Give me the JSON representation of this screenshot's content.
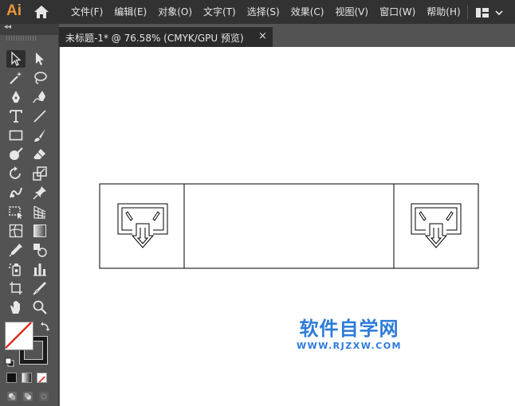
{
  "app": {
    "logo": "Ai"
  },
  "menubar": {
    "items": [
      "文件(F)",
      "编辑(E)",
      "对象(O)",
      "文字(T)",
      "选择(S)",
      "效果(C)",
      "视图(V)",
      "窗口(W)",
      "帮助(H)"
    ]
  },
  "document_tab": {
    "title": "未标题-1* @ 76.58% (CMYK/GPU 预览)",
    "close": "×"
  },
  "toolbar": {
    "collapse": "◂◂"
  },
  "watermark": {
    "title": "软件自学网",
    "url": "WWW.RJZXW.COM"
  },
  "colors": {
    "menubar_bg": "#323232",
    "panel_bg": "#535353",
    "logo": "#E8953A",
    "watermark": "#2C7BD8"
  }
}
